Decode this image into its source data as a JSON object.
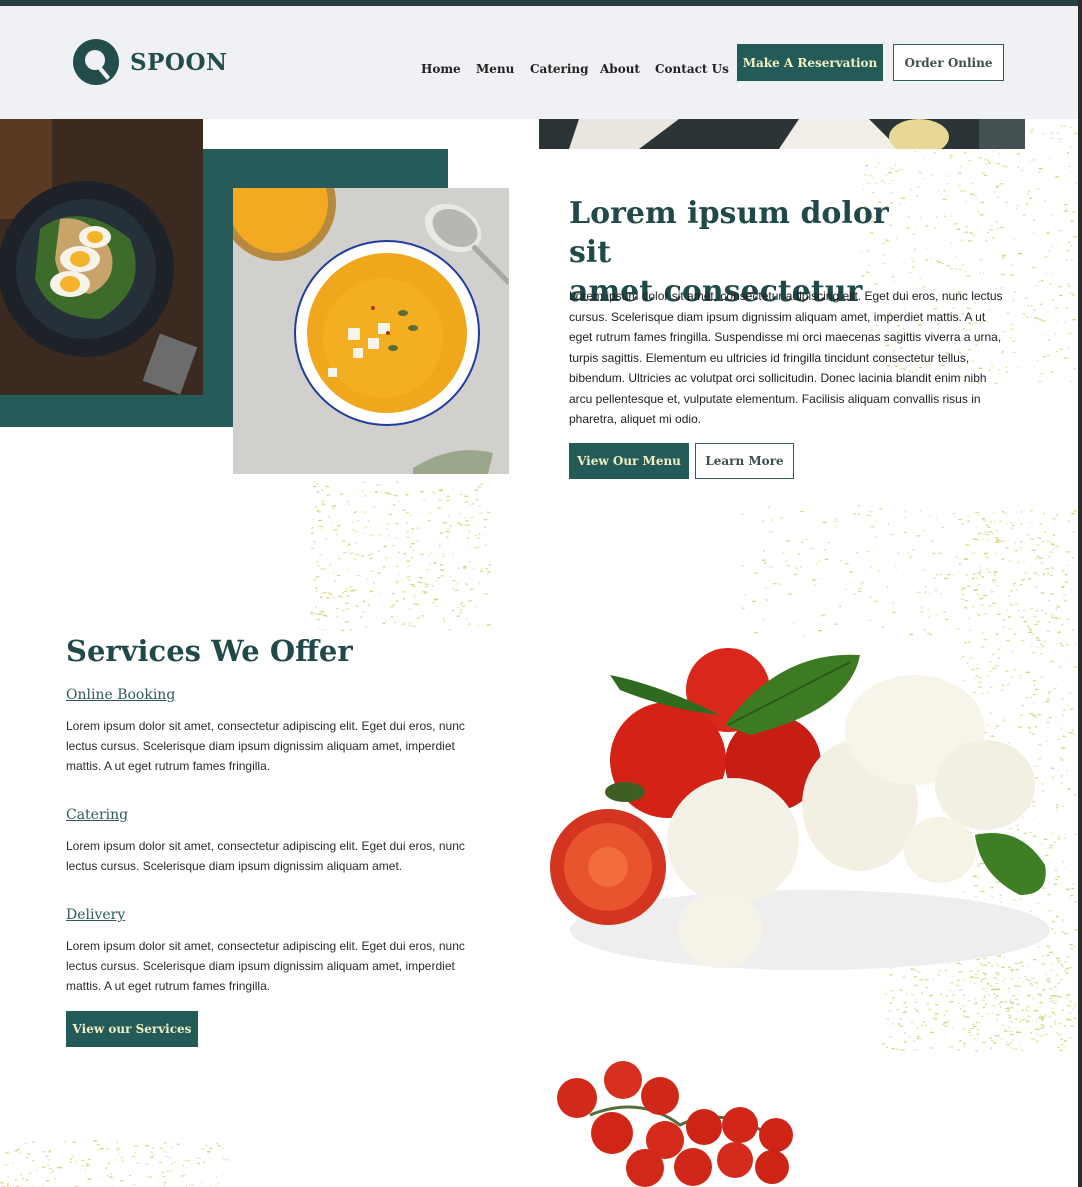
{
  "brand": {
    "name": "SPOON",
    "accent": "#245b59",
    "cta_text_color": "#f1f0c4",
    "speckle": "#c9c95a"
  },
  "nav": {
    "items": [
      "Home",
      "Menu",
      "Catering",
      "About",
      "Contact Us"
    ],
    "reserve_label": "Make A Reservation",
    "order_label": "Order Online"
  },
  "hero": {
    "title_line1": "Lorem ipsum dolor sit",
    "title_line2": "amet consectetur",
    "body": "Lorem ipsum dolor sit amet, consectetur adipiscing elit. Eget dui eros, nunc lectus cursus. Scelerisque diam ipsum dignissim aliquam amet, imperdiet mattis. A ut eget rutrum fames fringilla. Suspendisse mi orci maecenas sagittis viverra a urna, turpis sagittis. Elementum eu ultricies id fringilla tincidunt consectetur tellus, bibendum. Ultricies ac volutpat orci sollicitudin. Donec lacinia blandit enim nibh arcu pellentesque et, vulputate elementum. Facilisis aliquam convallis risus in pharetra, aliquet mi odio.",
    "menu_button": "View Our Menu",
    "learn_button": "Learn More"
  },
  "services": {
    "title": "Services We Offer",
    "items": [
      {
        "heading": "Online Booking",
        "text": "Lorem ipsum dolor sit amet, consectetur adipiscing elit. Eget dui eros, nunc lectus cursus. Scelerisque diam ipsum dignissim aliquam amet, imperdiet mattis. A ut eget rutrum fames fringilla."
      },
      {
        "heading": "Catering",
        "text": "Lorem ipsum dolor sit amet, consectetur adipiscing elit. Eget dui eros, nunc lectus cursus. Scelerisque diam ipsum dignissim aliquam amet."
      },
      {
        "heading": "Delivery",
        "text": "Lorem ipsum dolor sit amet, consectetur adipiscing elit. Eget dui eros, nunc lectus cursus. Scelerisque diam ipsum dignissim aliquam amet, imperdiet mattis. A ut eget rutrum fames fringilla."
      }
    ],
    "button": "View our Services"
  }
}
